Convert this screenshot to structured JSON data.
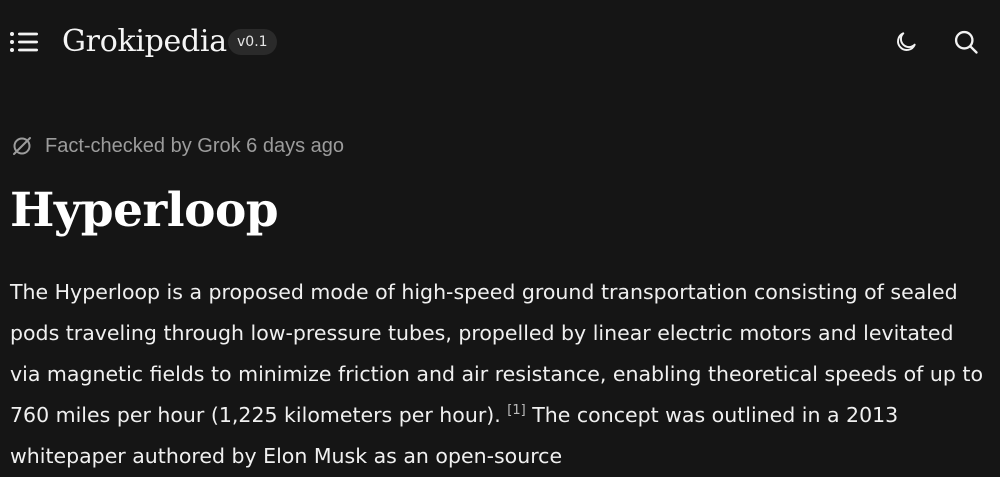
{
  "header": {
    "menu_icon": "list-menu-icon",
    "brand": "Grokipedia",
    "version": "v0.1",
    "theme_icon": "moon-icon",
    "search_icon": "search-icon"
  },
  "article": {
    "fact_check_icon": "circle-slash-icon",
    "fact_check": "Fact-checked by Grok 6 days ago",
    "title": "Hyperloop",
    "body_part1": "The Hyperloop is a proposed mode of high-speed ground transportation consisting of sealed pods traveling through low-pressure tubes, propelled by linear electric motors and levitated via magnetic fields to minimize friction and air resistance, enabling theoretical speeds of up to 760 miles per hour (1,225 kilometers per hour).",
    "citation": "[1]",
    "body_part2": "The concept was outlined in a 2013 whitepaper authored by Elon Musk as an open-source"
  },
  "colors": {
    "background": "#151515",
    "text": "#f2f2f2",
    "muted": "#9c9c9c",
    "badge": "#2a2a2a"
  }
}
